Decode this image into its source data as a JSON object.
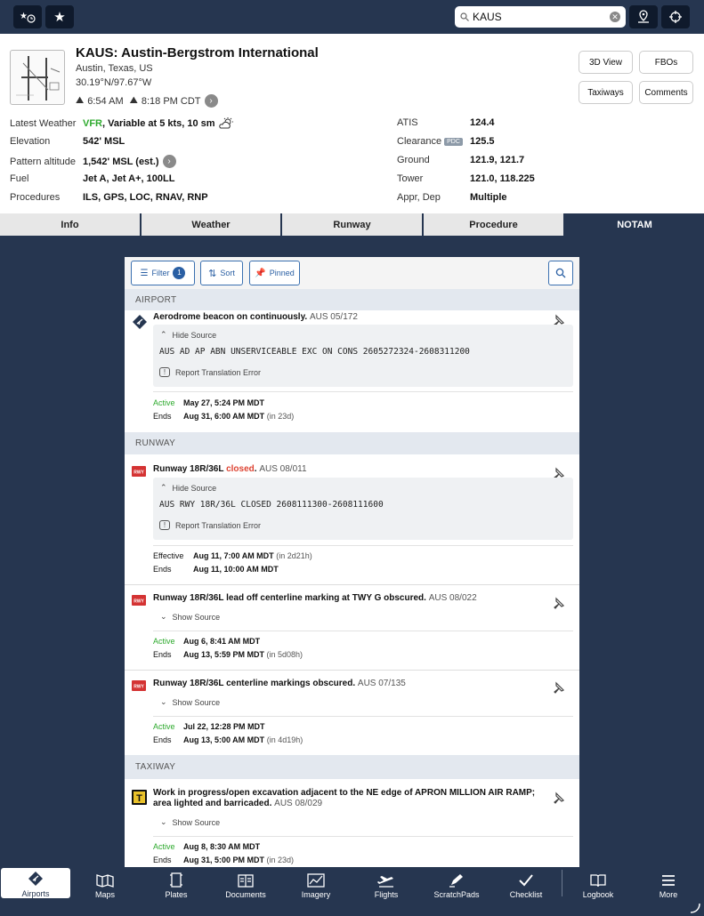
{
  "search": {
    "value": "KAUS"
  },
  "airport": {
    "title": "KAUS: Austin-Bergstrom International",
    "city": "Austin, Texas, US",
    "coords": "30.19°N/97.67°W",
    "sunrise": "6:54 AM",
    "sunset": "8:18 PM CDT"
  },
  "header_buttons": {
    "view3d": "3D View",
    "fbos": "FBOs",
    "taxiways": "Taxiways",
    "comments": "Comments"
  },
  "info_left": [
    {
      "label": "Latest Weather",
      "value_prefix": "VFR",
      "value": ", Variable at 5 kts, 10 sm"
    },
    {
      "label": "Elevation",
      "value": "542' MSL"
    },
    {
      "label": "Pattern altitude",
      "value": "1,542' MSL (est.)"
    },
    {
      "label": "Fuel",
      "value": "Jet A, Jet A+, 100LL"
    },
    {
      "label": "Procedures",
      "value": "ILS, GPS, LOC, RNAV, RNP"
    }
  ],
  "info_right": [
    {
      "label": "ATIS",
      "value": "124.4"
    },
    {
      "label": "Clearance",
      "badge": "PDC",
      "value": "125.5"
    },
    {
      "label": "Ground",
      "value": "121.9, 121.7"
    },
    {
      "label": "Tower",
      "value": "121.0, 118.225"
    },
    {
      "label": "Appr, Dep",
      "value": "Multiple"
    }
  ],
  "tabs": [
    "Info",
    "Weather",
    "Runway",
    "Procedure",
    "NOTAM"
  ],
  "active_tab": "NOTAM",
  "toolbar": {
    "filter": "Filter",
    "filter_count": "1",
    "sort": "Sort",
    "pinned": "Pinned"
  },
  "sections": {
    "airport": "AIRPORT",
    "runway": "RUNWAY",
    "taxiway": "TAXIWAY"
  },
  "source": {
    "hide": "Hide Source",
    "show": "Show Source",
    "report": "Report Translation Error"
  },
  "notams": [
    {
      "title": "Aerodrome beacon on continuously.",
      "ref": "AUS 05/172",
      "raw": "AUS AD AP ABN UNSERVICEABLE EXC ON CONS 2605272324-2608311200",
      "start_label": "Active",
      "start": "May 27, 5:24 PM MDT",
      "end_label": "Ends",
      "end": "Aug 31, 6:00 AM MDT",
      "end_rel": "(in 23d)"
    },
    {
      "title_pre": "Runway 18R/36L ",
      "title_status": "closed",
      "title_post": ".",
      "ref": "AUS 08/011",
      "raw": "AUS RWY 18R/36L CLOSED 2608111300-2608111600",
      "start_label": "Effective",
      "start": "Aug 11, 7:00 AM MDT",
      "start_rel": "(in 2d21h)",
      "end_label": "Ends",
      "end": "Aug 11, 10:00 AM MDT"
    },
    {
      "title": "Runway 18R/36L lead off centerline marking at TWY G obscured.",
      "ref": "AUS 08/022",
      "start_label": "Active",
      "start": "Aug 6, 8:41 AM MDT",
      "end_label": "Ends",
      "end": "Aug 13, 5:59 PM MDT",
      "end_rel": "(in 5d08h)"
    },
    {
      "title": "Runway 18R/36L centerline markings obscured.",
      "ref": "AUS 07/135",
      "start_label": "Active",
      "start": "Jul 22, 12:28 PM MDT",
      "end_label": "Ends",
      "end": "Aug 13, 5:00 AM MDT",
      "end_rel": "(in 4d19h)"
    },
    {
      "title": "Work in progress/open excavation adjacent to the NE edge of APRON MILLION AIR RAMP; area lighted and barricaded.",
      "ref": "AUS 08/029",
      "start_label": "Active",
      "start": "Aug 8, 8:30 AM MDT",
      "end_label": "Ends",
      "end": "Aug 31, 5:00 PM MDT",
      "end_rel": "(in 23d)"
    }
  ],
  "icons": {
    "rwy": "RWY",
    "taxiway": "T"
  },
  "bottom_nav": [
    "Airports",
    "Maps",
    "Plates",
    "Documents",
    "Imagery",
    "Flights",
    "ScratchPads",
    "Checklist",
    "Logbook",
    "More"
  ],
  "colors": {
    "navy": "#263650",
    "green": "#2eaa2e",
    "red": "#d43333",
    "blue": "#2a5fa3"
  }
}
